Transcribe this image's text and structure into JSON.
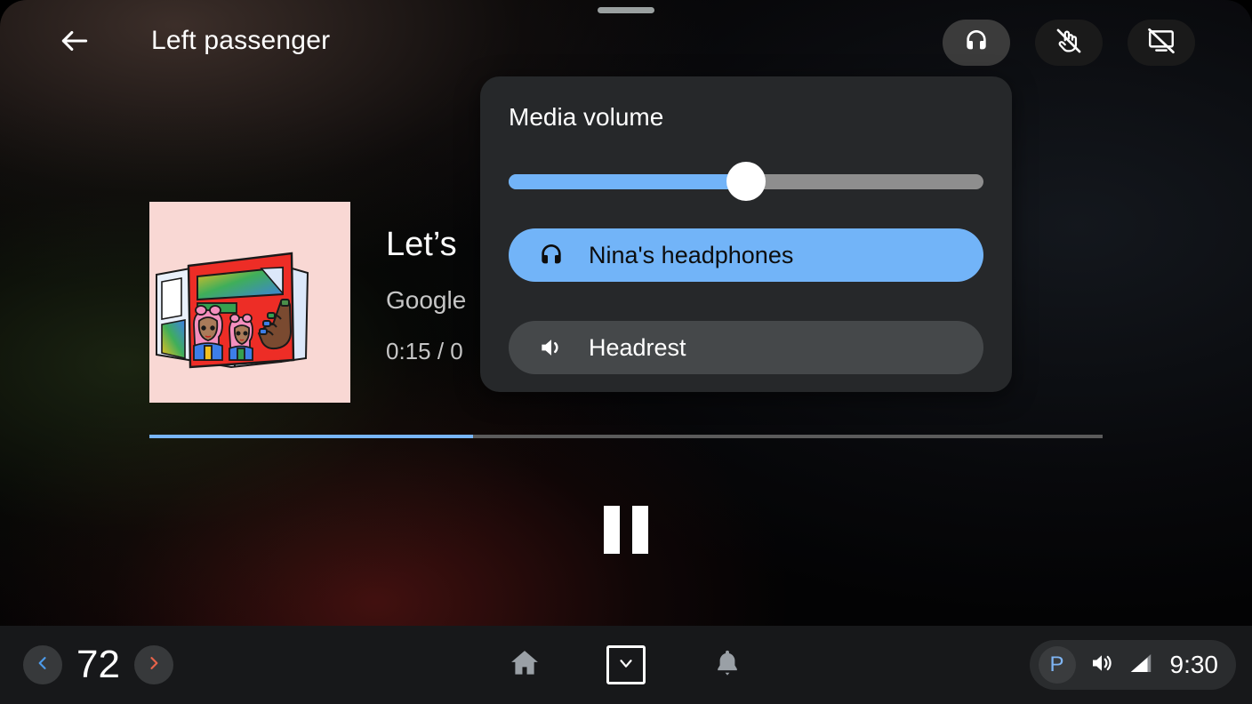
{
  "header": {
    "title": "Left passenger",
    "back_icon": "arrow-left-icon",
    "actions": [
      {
        "id": "headphones",
        "icon": "headphones-icon",
        "active": true
      },
      {
        "id": "touch-off",
        "icon": "touch-disabled-icon",
        "active": false
      },
      {
        "id": "screen-off",
        "icon": "screen-off-icon",
        "active": false
      }
    ]
  },
  "now_playing": {
    "title": "Let’s",
    "artist": "Google",
    "time": "0:15 / 0",
    "progress_percent": 34,
    "play_state": "playing",
    "play_pause_icon": "pause-icon",
    "album_art_alt": "illustration of two women with pink hair holding a red magazine"
  },
  "volume_popup": {
    "title": "Media volume",
    "slider": {
      "name": "media-volume-slider",
      "value_percent": 50,
      "fill_color": "#72b4f8",
      "track_color": "#8e8e8e",
      "thumb_color": "#ffffff"
    },
    "devices": [
      {
        "label": "Nina's headphones",
        "icon": "headphones-icon",
        "selected": true,
        "bg_color": "#72b4f8"
      },
      {
        "label": "Headrest",
        "icon": "speaker-icon",
        "selected": false,
        "bg_color": "#45484a"
      }
    ]
  },
  "status_bar": {
    "temperature": "72",
    "temp_down_icon": "chevron-left-icon",
    "temp_up_icon": "chevron-right-icon",
    "temp_down_color": "#4d9bea",
    "temp_up_color": "#e8634a",
    "nav": [
      {
        "id": "home",
        "icon": "home-icon"
      },
      {
        "id": "apps",
        "icon": "chevron-down-icon"
      },
      {
        "id": "notifications",
        "icon": "bell-icon"
      }
    ],
    "system": {
      "gear_label": "P",
      "gear_color": "#7fb5f4",
      "volume_icon": "volume-icon",
      "signal_icon": "signal-icon",
      "clock": "9:30"
    }
  }
}
